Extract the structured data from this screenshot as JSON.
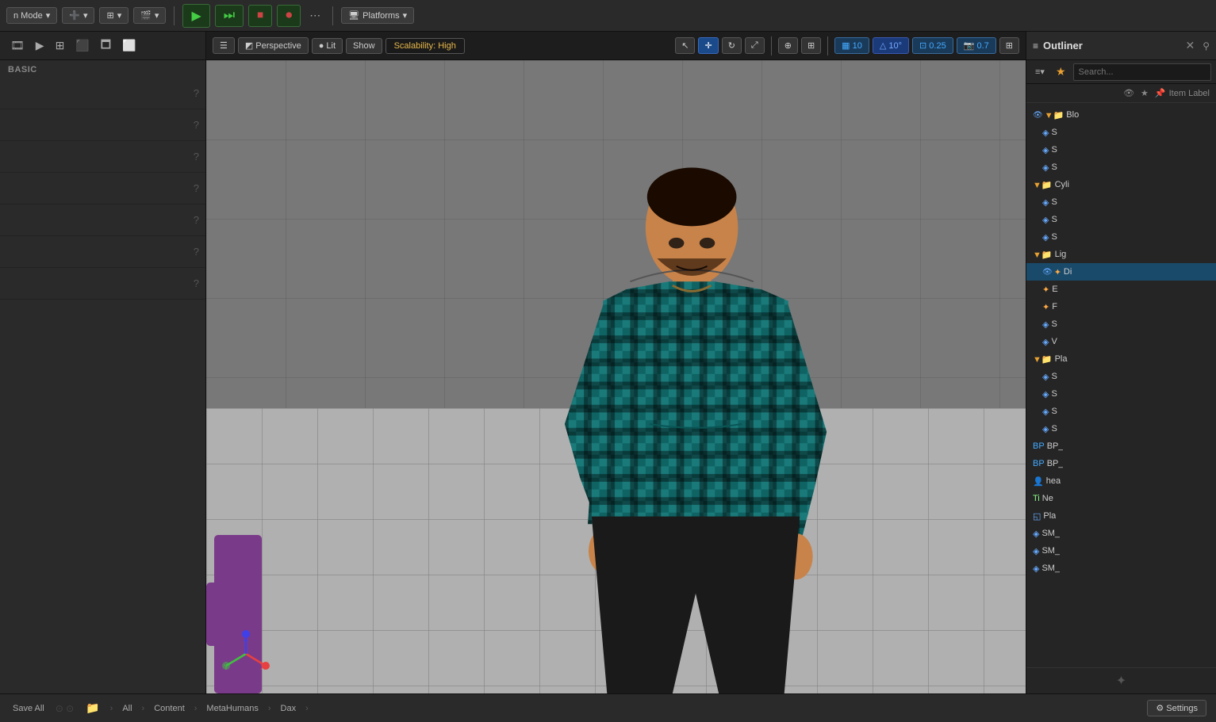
{
  "topToolbar": {
    "modeLabel": "n Mode",
    "playLabel": "▶",
    "skipLabel": "⏭",
    "stopLabel": "⏹",
    "recordLabel": "⏺",
    "moreLabel": "⋯",
    "platformsLabel": "Platforms",
    "platformsDropdown": true
  },
  "leftPanel": {
    "sectionLabel": "BASIC",
    "rows": [
      {
        "id": 1,
        "label": ""
      },
      {
        "id": 2,
        "label": ""
      },
      {
        "id": 3,
        "label": ""
      },
      {
        "id": 4,
        "label": ""
      },
      {
        "id": 5,
        "label": ""
      },
      {
        "id": 6,
        "label": ""
      },
      {
        "id": 7,
        "label": ""
      }
    ]
  },
  "viewport": {
    "hamburgerIcon": "☰",
    "perspectiveLabel": "Perspective",
    "litLabel": "Lit",
    "showLabel": "Show",
    "scalabilityLabel": "Scalability: High",
    "tools": {
      "selectIcon": "↖",
      "moveIcon": "✛",
      "rotateIcon": "↻",
      "scaleIcon": "⤢",
      "worldIcon": "⊕",
      "cameraIcon": "⊞",
      "gridIcon": "▦",
      "gridValue": "10",
      "angleIcon": "△",
      "angleValue": "10°",
      "snapIcon": "⊡",
      "snapValue": "0.25",
      "cameraSpeedValue": "0.7",
      "layoutIcon": "⊞"
    }
  },
  "outliner": {
    "title": "Outliner",
    "searchPlaceholder": "Search...",
    "itemLabelHeader": "Item Label",
    "treeItems": [
      {
        "id": 1,
        "indent": 0,
        "type": "folder",
        "label": "Blo",
        "expanded": true,
        "icon": "📁",
        "vis": true
      },
      {
        "id": 2,
        "indent": 1,
        "type": "mesh",
        "label": "S",
        "icon": "◈"
      },
      {
        "id": 3,
        "indent": 1,
        "type": "mesh",
        "label": "S",
        "icon": "◈"
      },
      {
        "id": 4,
        "indent": 1,
        "type": "mesh",
        "label": "S",
        "icon": "◈"
      },
      {
        "id": 5,
        "indent": 0,
        "type": "folder",
        "label": "Cyli",
        "expanded": true,
        "icon": "📁"
      },
      {
        "id": 6,
        "indent": 1,
        "type": "mesh",
        "label": "S",
        "icon": "◈"
      },
      {
        "id": 7,
        "indent": 1,
        "type": "mesh",
        "label": "S",
        "icon": "◈"
      },
      {
        "id": 8,
        "indent": 1,
        "type": "mesh",
        "label": "S",
        "icon": "◈"
      },
      {
        "id": 9,
        "indent": 0,
        "type": "folder",
        "label": "Lig",
        "expanded": true,
        "icon": "📁"
      },
      {
        "id": 10,
        "indent": 1,
        "type": "light",
        "label": "Di",
        "icon": "◉",
        "selected": true,
        "vis": true
      },
      {
        "id": 11,
        "indent": 1,
        "type": "light",
        "label": "E",
        "icon": "◈"
      },
      {
        "id": 12,
        "indent": 1,
        "type": "light",
        "label": "F",
        "icon": "◈"
      },
      {
        "id": 13,
        "indent": 1,
        "type": "mesh",
        "label": "S",
        "icon": "◈"
      },
      {
        "id": 14,
        "indent": 1,
        "type": "mesh",
        "label": "V",
        "icon": "◈"
      },
      {
        "id": 15,
        "indent": 0,
        "type": "folder",
        "label": "Pla",
        "expanded": true,
        "icon": "📁"
      },
      {
        "id": 16,
        "indent": 1,
        "type": "mesh",
        "label": "S",
        "icon": "◈"
      },
      {
        "id": 17,
        "indent": 1,
        "type": "mesh",
        "label": "S",
        "icon": "◈"
      },
      {
        "id": 18,
        "indent": 1,
        "type": "mesh",
        "label": "S",
        "icon": "◈"
      },
      {
        "id": 19,
        "indent": 1,
        "type": "mesh",
        "label": "S",
        "icon": "◈"
      },
      {
        "id": 20,
        "indent": 0,
        "type": "blueprint",
        "label": "BP_",
        "icon": "🔵"
      },
      {
        "id": 21,
        "indent": 0,
        "type": "blueprint",
        "label": "BP_",
        "icon": "🔵"
      },
      {
        "id": 22,
        "indent": 0,
        "type": "human",
        "label": "hea",
        "icon": "👤"
      },
      {
        "id": 23,
        "indent": 0,
        "type": "note",
        "label": "Ne",
        "icon": "📝"
      },
      {
        "id": 24,
        "indent": 0,
        "type": "plane",
        "label": "Pla",
        "icon": "◱"
      },
      {
        "id": 25,
        "indent": 0,
        "type": "mesh",
        "label": "SM_",
        "icon": "◈"
      },
      {
        "id": 26,
        "indent": 0,
        "type": "mesh",
        "label": "SM_",
        "icon": "◈"
      },
      {
        "id": 27,
        "indent": 0,
        "type": "mesh",
        "label": "SM_",
        "icon": "◈"
      }
    ]
  },
  "bottomBar": {
    "saveAllLabel": "Save All",
    "breadcrumbs": [
      "All",
      "Content",
      "MetaHumans",
      "Dax"
    ],
    "settingsLabel": "Settings"
  }
}
